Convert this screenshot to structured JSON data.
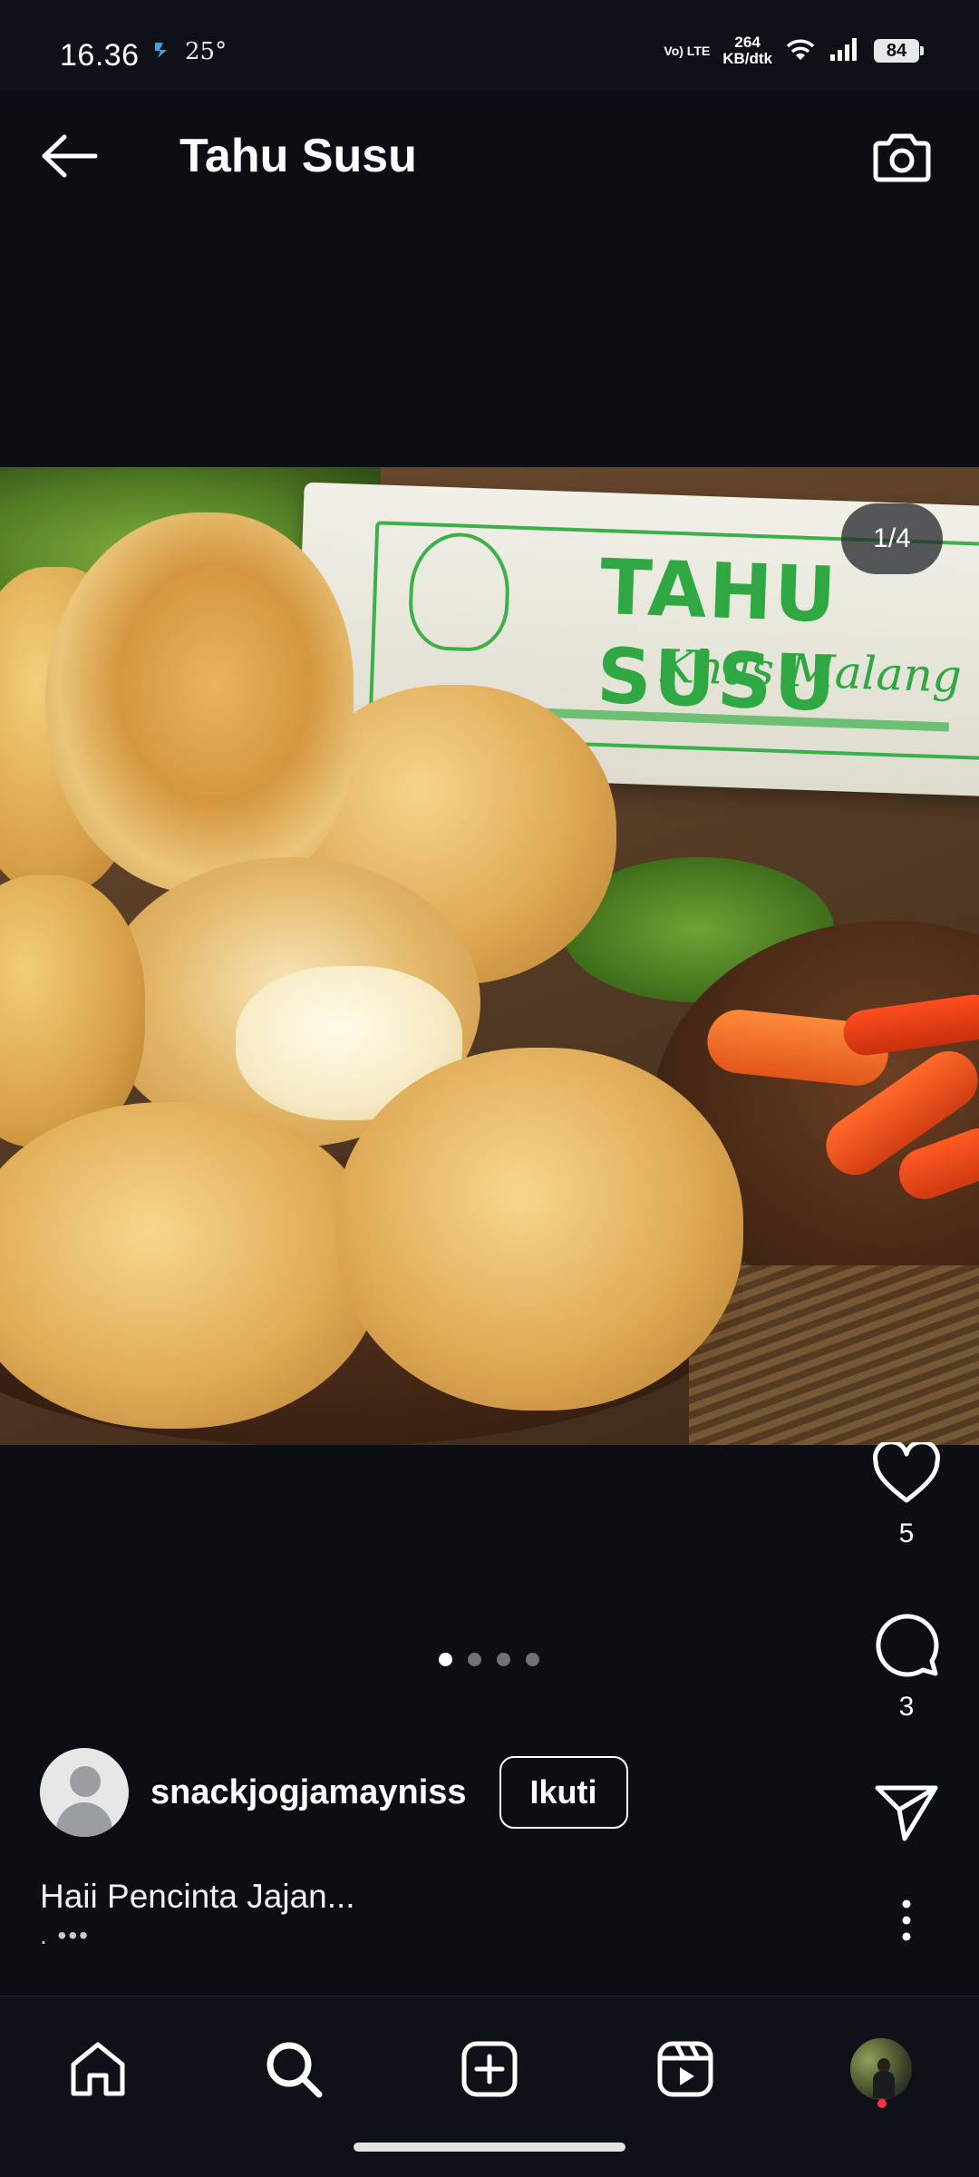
{
  "status_bar": {
    "time": "16.36",
    "temperature": "25°",
    "volte_label": "Vo) LTE",
    "net_speed_value": "264",
    "net_speed_unit": "KB/dtk",
    "battery": "84"
  },
  "header": {
    "title": "Tahu Susu",
    "back_icon": "arrow-left-icon",
    "camera_icon": "camera-icon"
  },
  "post": {
    "page_counter": "1/4",
    "image_texts": {
      "package_brand": "TAHU SUSU",
      "package_sub": "Khas Malang"
    },
    "dots_total": 4,
    "dots_active": 0,
    "author": {
      "username": "snackjogjamayniss",
      "follow_label": "Ikuti"
    },
    "caption": "Haii Pencinta Jajan...",
    "caption_more": ". •••"
  },
  "actions": {
    "like_count": "5",
    "comment_count": "3",
    "like_icon": "heart-icon",
    "comment_icon": "comment-icon",
    "share_icon": "send-icon",
    "more_icon": "more-vertical-icon"
  },
  "bottom_nav": {
    "items": [
      "home-icon",
      "search-icon",
      "add-post-icon",
      "reels-icon",
      "profile-avatar"
    ]
  },
  "colors": {
    "background": "#0b0e13",
    "text": "#ffffff",
    "notification_dot": "#ff3040"
  }
}
